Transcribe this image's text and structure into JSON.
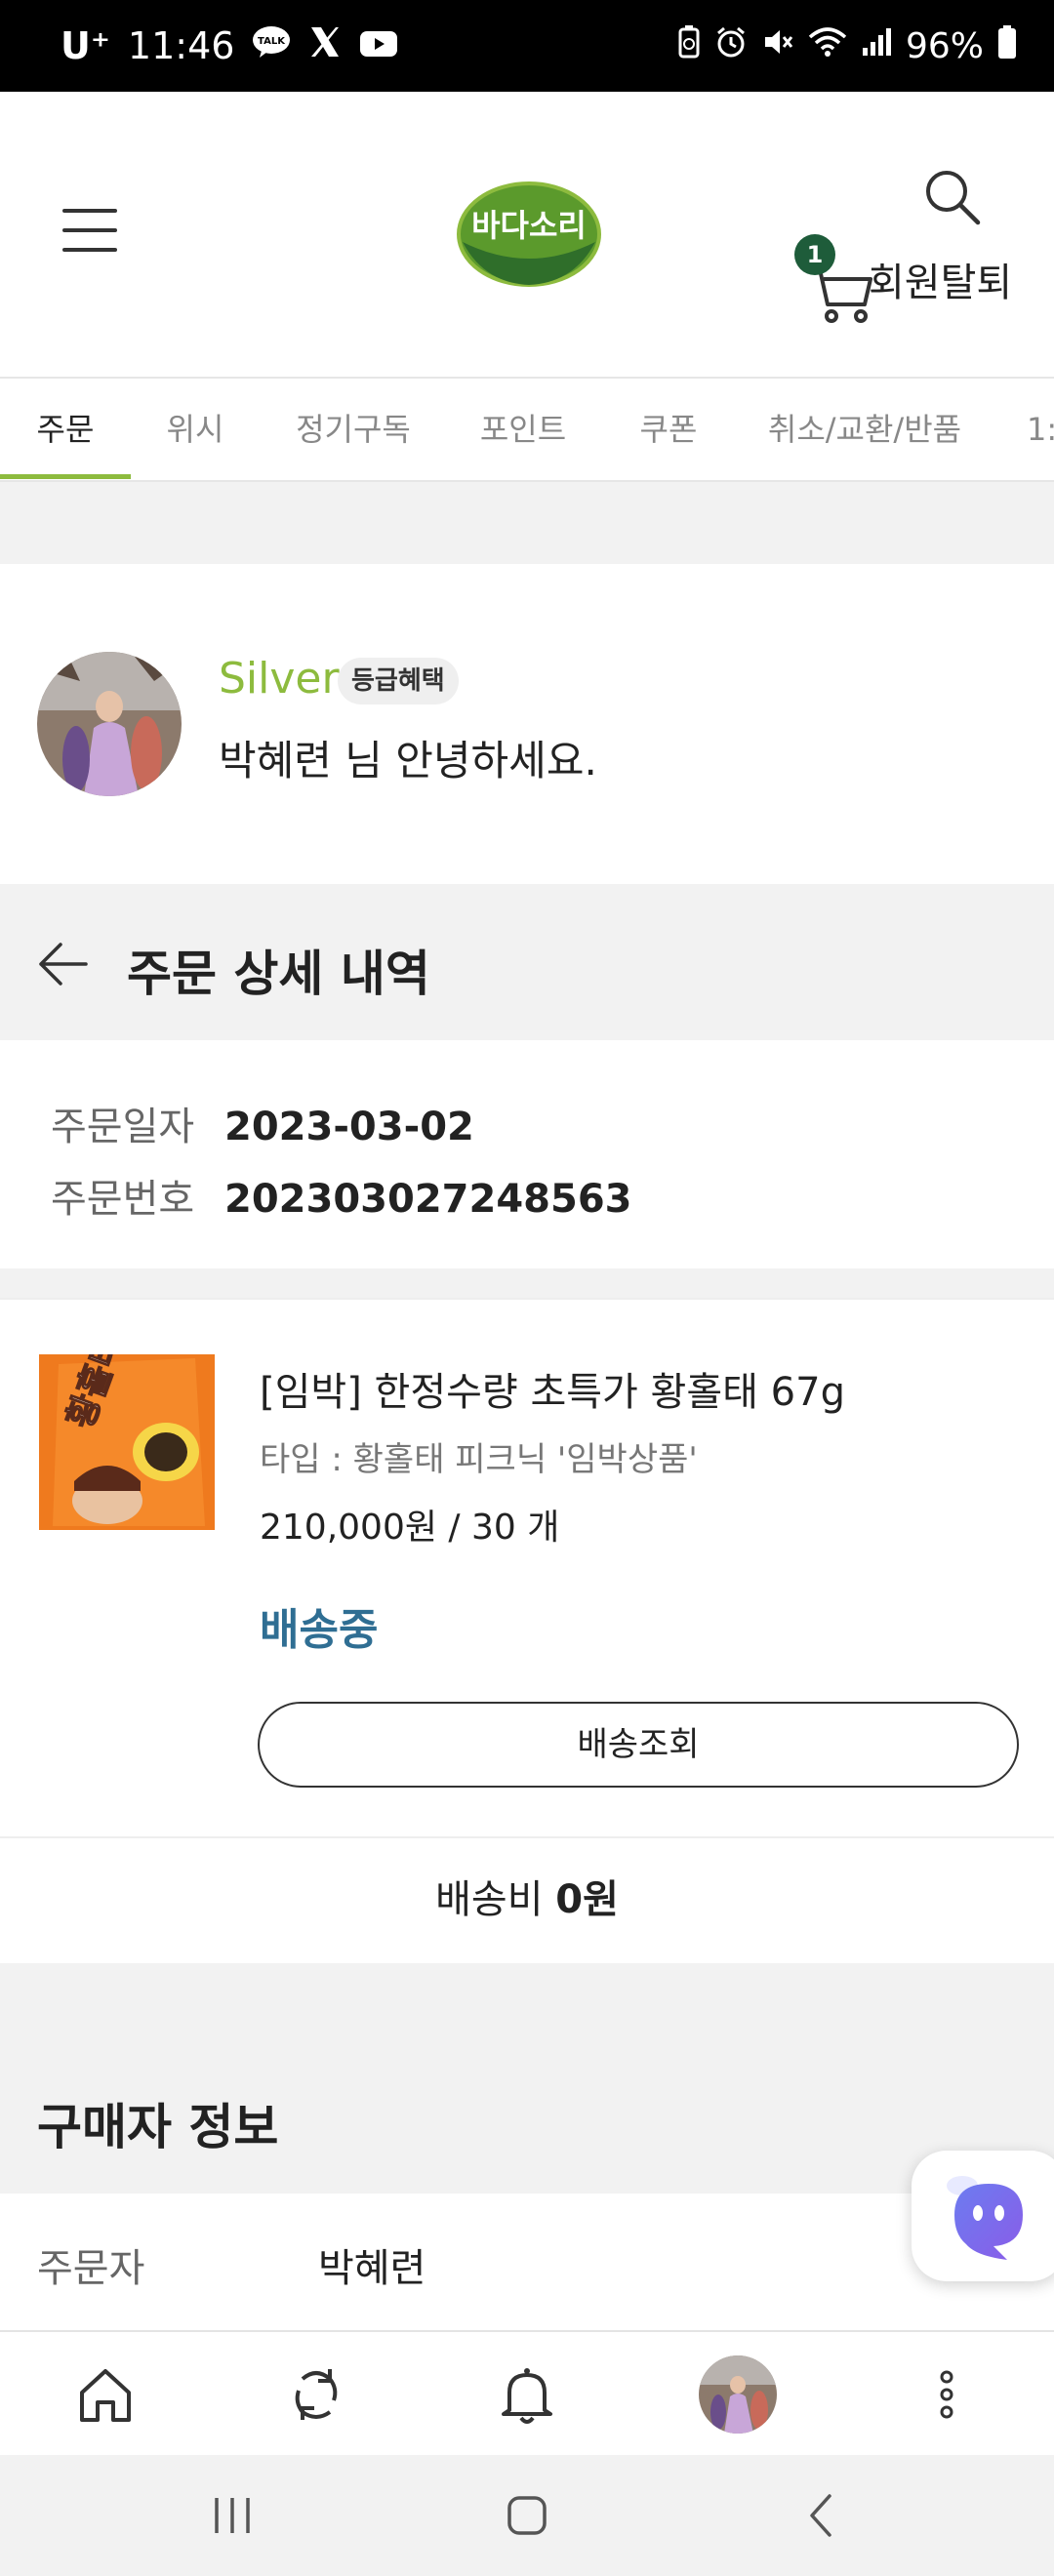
{
  "status_bar": {
    "carrier": "U⁺",
    "time": "11:46",
    "battery": "96%",
    "left_icons": [
      "talk-icon",
      "x-icon",
      "youtube-icon"
    ],
    "right_icons": [
      "battery-saver-icon",
      "alarm-icon",
      "mute-icon",
      "wifi-icon",
      "signal-icon",
      "battery-icon"
    ]
  },
  "header": {
    "logo_text": "바다소리",
    "cart_count": "1",
    "withdraw_label": "회원탈퇴",
    "brand_color": "#8dbb3e"
  },
  "tabs": [
    {
      "label": "주문",
      "active": true
    },
    {
      "label": "위시",
      "active": false
    },
    {
      "label": "정기구독",
      "active": false
    },
    {
      "label": "포인트",
      "active": false
    },
    {
      "label": "쿠폰",
      "active": false
    },
    {
      "label": "취소/교환/반품",
      "active": false
    },
    {
      "label": "1:",
      "active": false
    }
  ],
  "member": {
    "grade": "Silver",
    "grade_benefit_label": "등급혜택",
    "greeting": "박혜련 님 안녕하세요."
  },
  "order_detail": {
    "title": "주문 상세 내역",
    "date_label": "주문일자",
    "date_value": "2023-03-02",
    "number_label": "주문번호",
    "number_value": "202303027248563"
  },
  "product": {
    "thumb_text": "황홀태",
    "name": "[임박] 한정수량 초특가 황홀태 67g",
    "option": "타입 : 황홀태 피크닉 '임박상품'",
    "price_qty": "210,000원 / 30 개",
    "status": "배송중",
    "status_color": "#2f6e93",
    "track_button": "배송조회"
  },
  "shipping": {
    "label": "배송비",
    "value": "0원"
  },
  "buyer": {
    "title": "구매자 정보",
    "orderer_label": "주문자",
    "orderer_value": "박혜련"
  },
  "bottom_nav": [
    "home-icon",
    "refresh-icon",
    "bell-icon",
    "profile-avatar",
    "more-icon"
  ],
  "system_nav": [
    "recents-icon",
    "home-circle-icon",
    "back-icon"
  ]
}
